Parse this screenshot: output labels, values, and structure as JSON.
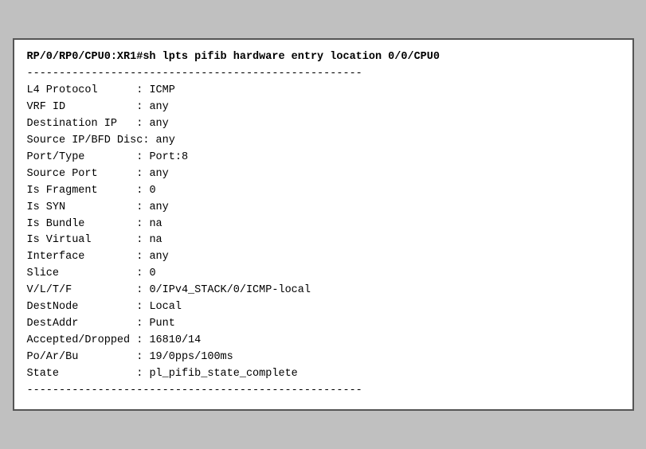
{
  "terminal": {
    "command": "RP/0/RP0/CPU0:XR1#sh lpts pifib hardware entry location 0/0/CPU0",
    "separator": "----------------------------------------------------",
    "rows": [
      {
        "label": "L4 Protocol",
        "colon": " : ",
        "value": "ICMP"
      },
      {
        "label": "VRF ID",
        "colon": "     : ",
        "value": "any"
      },
      {
        "label": "Destination IP",
        "colon": "  : ",
        "value": "any"
      },
      {
        "label": "Source IP/BFD Disc",
        "colon": ": ",
        "value": "any"
      },
      {
        "label": "Port/Type",
        "colon": "       : ",
        "value": "Port:8"
      },
      {
        "label": "Source Port",
        "colon": "     : ",
        "value": "any"
      },
      {
        "label": "Is Fragment",
        "colon": "     : ",
        "value": "0"
      },
      {
        "label": "Is SYN",
        "colon": "         : ",
        "value": "any"
      },
      {
        "label": "Is Bundle",
        "colon": "      : ",
        "value": "na"
      },
      {
        "label": "Is Virtual",
        "colon": "     : ",
        "value": "na"
      },
      {
        "label": "Interface",
        "colon": "      : ",
        "value": "any"
      },
      {
        "label": "Slice",
        "colon": "          : ",
        "value": "0"
      },
      {
        "label": "V/L/T/F",
        "colon": "        : ",
        "value": "0/IPv4_STACK/0/ICMP-local"
      },
      {
        "label": "DestNode",
        "colon": "       : ",
        "value": "Local"
      },
      {
        "label": "DestAddr",
        "colon": "       : ",
        "value": "Punt"
      },
      {
        "label": "Accepted/Dropped",
        "colon": " : ",
        "value": "16810/14"
      },
      {
        "label": "Po/Ar/Bu",
        "colon": "       : ",
        "value": "19/0pps/100ms"
      },
      {
        "label": "State",
        "colon": "          : ",
        "value": "pl_pifib_state_complete"
      }
    ],
    "separator_bottom": "----------------------------------------------------"
  }
}
